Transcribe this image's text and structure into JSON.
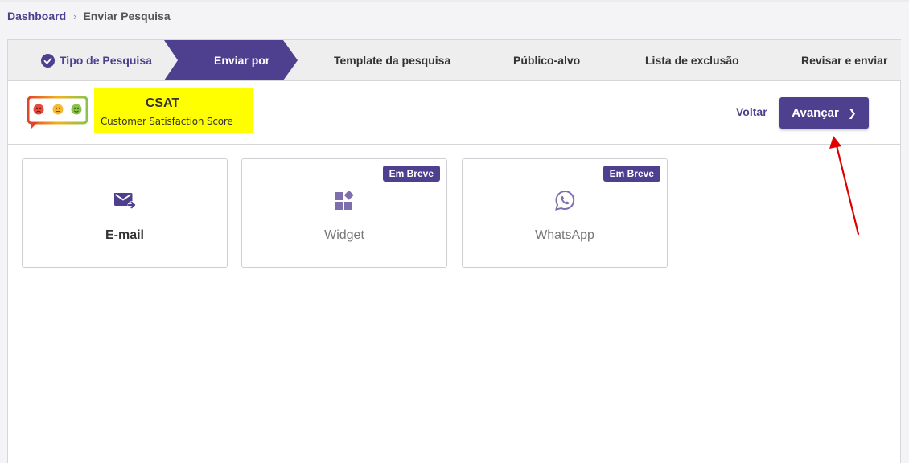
{
  "breadcrumb": {
    "root": "Dashboard",
    "separator": "›",
    "current": "Enviar Pesquisa"
  },
  "stepper": {
    "steps": [
      {
        "label": "Tipo de Pesquisa",
        "state": "done",
        "icon": "check-circle-icon"
      },
      {
        "label": "Enviar por",
        "state": "active"
      },
      {
        "label": "Template da pesquisa",
        "state": "pending"
      },
      {
        "label": "Público-alvo",
        "state": "pending"
      },
      {
        "label": "Lista de exclusão",
        "state": "pending"
      },
      {
        "label": "Revisar e enviar",
        "state": "pending"
      }
    ]
  },
  "survey": {
    "title": "CSAT",
    "subtitle": "Customer Satisfaction Score",
    "logo_icon": "csat-faces-icon",
    "highlight_color": "#ffff00"
  },
  "actions": {
    "back_label": "Voltar",
    "next_label": "Avançar",
    "next_icon": "chevron-right-icon"
  },
  "channels": [
    {
      "label": "E-mail",
      "icon": "email-send-icon",
      "badge": "",
      "enabled": true
    },
    {
      "label": "Widget",
      "icon": "widgets-icon",
      "badge": "Em Breve",
      "enabled": false
    },
    {
      "label": "WhatsApp",
      "icon": "whatsapp-icon",
      "badge": "Em Breve",
      "enabled": false
    }
  ],
  "colors": {
    "brand": "#4e3f8f",
    "annotation": "#e00000"
  }
}
